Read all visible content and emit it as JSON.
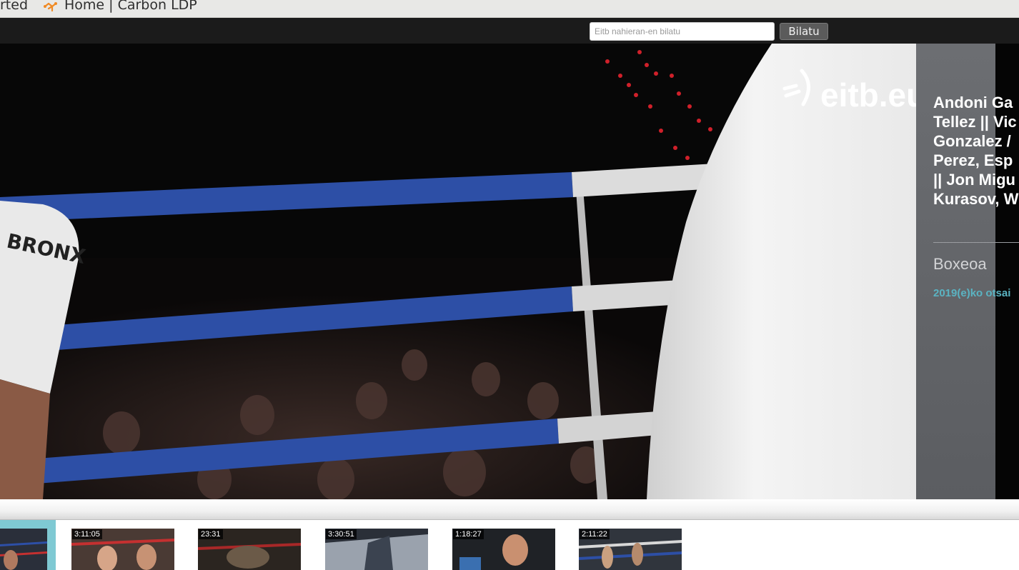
{
  "bookmarks": {
    "items": [
      {
        "label": "rted"
      },
      {
        "label": "Home | Carbon LDP",
        "icon": "carbon-ldp-icon"
      }
    ]
  },
  "search": {
    "placeholder": "Eitb nahieran-en bilatu",
    "button_label": "Bilatu"
  },
  "player": {
    "logo_text": "eitb.eus",
    "title": "Andoni Ga\nTellez || Vic\nGonzalez /\nPerez, Esp\n|| Jon Migu\nKurasov, W",
    "category": "Boxeoa",
    "date": "2019(e)ko otsai"
  },
  "thumbnails": [
    {
      "duration": ""
    },
    {
      "duration": "3:11:05"
    },
    {
      "duration": "23:31"
    },
    {
      "duration": "3:30:51"
    },
    {
      "duration": "1:18:27"
    },
    {
      "duration": "2:11:22"
    }
  ],
  "colors": {
    "topbar": "#1b1b1b",
    "info_panel": "#65676b",
    "date_link": "#5ab3c2",
    "active_thumb": "#7fc9d3",
    "ring_rope": "#2d4fa6"
  }
}
